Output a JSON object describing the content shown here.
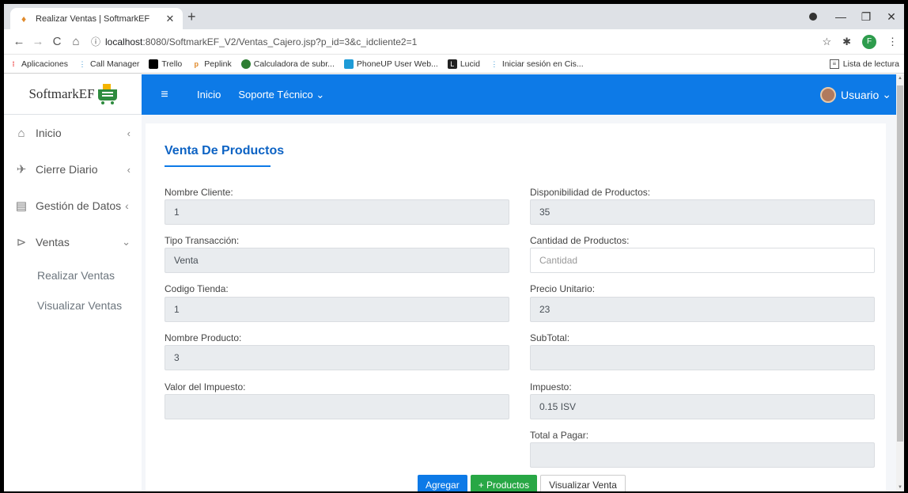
{
  "browser": {
    "tab_title": "Realizar Ventas | SoftmarkEF",
    "url_host": "localhost",
    "url_rest": ":8080/SoftmarkEF_V2/Ventas_Cajero.jsp?p_id=3&c_idcliente2=1",
    "profile_letter": "F",
    "bookmarks": [
      "Aplicaciones",
      "Call Manager",
      "Trello",
      "Peplink",
      "Calculadora de subr...",
      "PhoneUP User Web...",
      "Lucid",
      "Iniciar sesión en Cis..."
    ],
    "reading_list": "Lista de lectura"
  },
  "brand": {
    "name": "SoftmarkEF"
  },
  "topnav": {
    "inicio": "Inicio",
    "soporte": "Soporte Técnico",
    "user": "Usuario"
  },
  "sidebar": {
    "items": [
      {
        "label": "Inicio"
      },
      {
        "label": "Cierre Diario"
      },
      {
        "label": "Gestión de Datos"
      },
      {
        "label": "Ventas"
      }
    ],
    "sub": [
      "Realizar Ventas",
      "Visualizar Ventas"
    ]
  },
  "form": {
    "title": "Venta De Productos",
    "left": [
      {
        "label": "Nombre Cliente:",
        "value": "1"
      },
      {
        "label": "Tipo Transacción:",
        "value": "Venta"
      },
      {
        "label": "Codigo Tienda:",
        "value": "1"
      },
      {
        "label": "Nombre Producto:",
        "value": "3"
      },
      {
        "label": "Valor del Impuesto:",
        "value": ""
      }
    ],
    "right": [
      {
        "label": "Disponibilidad de Productos:",
        "value": "35"
      },
      {
        "label": "Cantidad de Productos:",
        "placeholder": "Cantidad"
      },
      {
        "label": "Precio Unitario:",
        "value": "23"
      },
      {
        "label": "SubTotal:",
        "value": ""
      },
      {
        "label": "Impuesto:",
        "value": "0.15 ISV"
      },
      {
        "label": "Total a Pagar:",
        "value": ""
      }
    ],
    "buttons": {
      "agregar": "Agregar",
      "productos": "+ Productos",
      "visualizar": "Visualizar Venta"
    }
  }
}
